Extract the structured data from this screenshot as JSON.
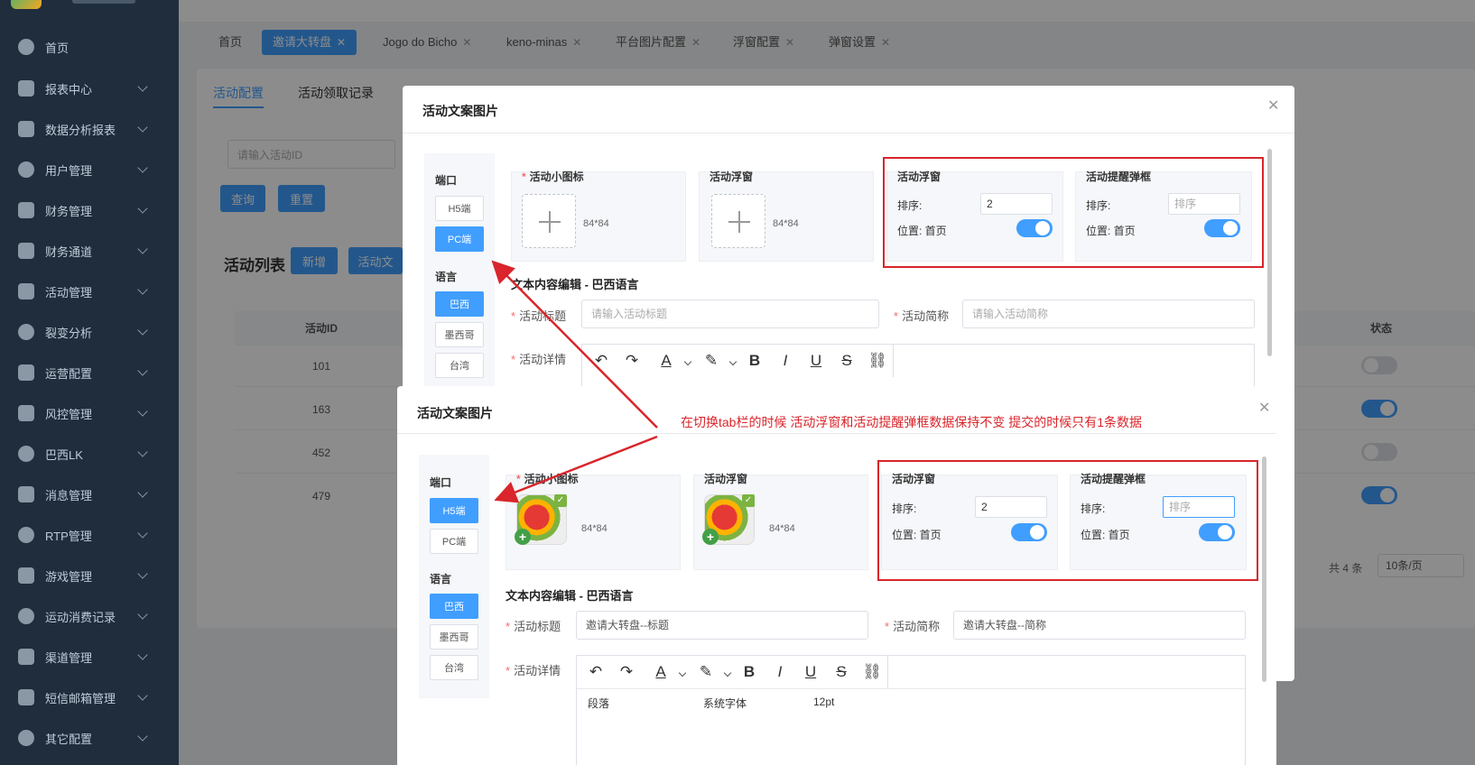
{
  "sidebar": {
    "items": [
      {
        "label": "首页",
        "icon": "home-icon"
      },
      {
        "label": "报表中心",
        "icon": "chart-icon"
      },
      {
        "label": "数据分析报表",
        "icon": "grid-icon"
      },
      {
        "label": "用户管理",
        "icon": "user-icon"
      },
      {
        "label": "财务管理",
        "icon": "finance-icon"
      },
      {
        "label": "财务通道",
        "icon": "finance-channel-icon"
      },
      {
        "label": "活动管理",
        "icon": "gift-icon"
      },
      {
        "label": "裂变分析",
        "icon": "user-group-icon"
      },
      {
        "label": "运营配置",
        "icon": "grid-icon"
      },
      {
        "label": "风控管理",
        "icon": "tree-icon"
      },
      {
        "label": "巴西LK",
        "icon": "coin-icon"
      },
      {
        "label": "消息管理",
        "icon": "message-icon"
      },
      {
        "label": "RTP管理",
        "icon": "globe-icon"
      },
      {
        "label": "游戏管理",
        "icon": "game-icon"
      },
      {
        "label": "运动消费记录",
        "icon": "sport-icon"
      },
      {
        "label": "渠道管理",
        "icon": "channel-icon"
      },
      {
        "label": "短信邮箱管理",
        "icon": "mail-icon"
      },
      {
        "label": "其它配置",
        "icon": "settings-icon"
      }
    ]
  },
  "tabs": [
    {
      "label": "首页",
      "active": false,
      "closable": false
    },
    {
      "label": "邀请大转盘",
      "active": true,
      "closable": true
    },
    {
      "label": "Jogo do Bicho",
      "active": false,
      "closable": true
    },
    {
      "label": "keno-minas",
      "active": false,
      "closable": true
    },
    {
      "label": "平台图片配置",
      "active": false,
      "closable": true
    },
    {
      "label": "浮窗配置",
      "active": false,
      "closable": true
    },
    {
      "label": "弹窗设置",
      "active": false,
      "closable": true
    }
  ],
  "page": {
    "subtabs": [
      "活动配置",
      "活动领取记录"
    ],
    "search_placeholder": "请输入活动ID",
    "query_button": "查询",
    "reset_button": "重置",
    "list_title": "活动列表",
    "add_button": "新增",
    "copy_button": "活动文",
    "table": {
      "headers": {
        "id": "活动ID",
        "status": "状态"
      },
      "rows": [
        {
          "id": "101",
          "status_on": false
        },
        {
          "id": "163",
          "status_on": true
        },
        {
          "id": "452",
          "status_on": false
        },
        {
          "id": "479",
          "status_on": true
        }
      ]
    },
    "pager": {
      "total": "共 4 条",
      "page_size": "10条/页"
    }
  },
  "dialog_top": {
    "title": "活动文案图片",
    "port_label": "端口",
    "ports": [
      "H5端",
      "PC端"
    ],
    "active_port": "PC端",
    "lang_label": "语言",
    "languages": [
      "巴西",
      "墨西哥",
      "台湾"
    ],
    "active_lang": "巴西",
    "icon_box": {
      "title": "活动小图标",
      "size": "84*84"
    },
    "float_box": {
      "title": "活动浮窗",
      "size": "84*84"
    },
    "float_cfg": {
      "title": "活动浮窗",
      "order_label": "排序:",
      "order_value": "2",
      "position": "位置: 首页"
    },
    "popup_cfg": {
      "title": "活动提醒弹框",
      "order_label": "排序:",
      "order_placeholder": "排序",
      "position": "位置: 首页"
    },
    "section_title": "文本内容编辑 - 巴西语言",
    "title_label": "活动标题",
    "title_placeholder": "请输入活动标题",
    "short_label": "活动简称",
    "short_placeholder": "请输入活动简称",
    "detail_label": "活动详情"
  },
  "dialog_bottom": {
    "title": "活动文案图片",
    "port_label": "端口",
    "ports": [
      "H5端",
      "PC端"
    ],
    "active_port": "H5端",
    "lang_label": "语言",
    "languages": [
      "巴西",
      "墨西哥",
      "台湾"
    ],
    "active_lang": "巴西",
    "icon_box": {
      "title": "活动小图标",
      "size": "84*84"
    },
    "float_box": {
      "title": "活动浮窗",
      "size": "84*84"
    },
    "float_cfg": {
      "title": "活动浮窗",
      "order_label": "排序:",
      "order_value": "2",
      "position": "位置: 首页"
    },
    "popup_cfg": {
      "title": "活动提醒弹框",
      "order_label": "排序:",
      "order_placeholder": "排序",
      "position": "位置: 首页"
    },
    "section_title": "文本内容编辑 - 巴西语言",
    "title_label": "活动标题",
    "title_value": "邀请大转盘--标题",
    "short_label": "活动简称",
    "short_value": "邀请大转盘--简称",
    "detail_label": "活动详情",
    "editor_row2": {
      "paragraph": "段落",
      "font": "系统字体",
      "size": "12pt"
    }
  },
  "annotation": "在切换tab栏的时候  活动浮窗和活动提醒弹框数据保持不变 提交的时候只有1条数据",
  "colors": {
    "primary": "#409eff",
    "annotation_red": "#d9252b",
    "sidebar_bg": "#1f2d3d"
  }
}
